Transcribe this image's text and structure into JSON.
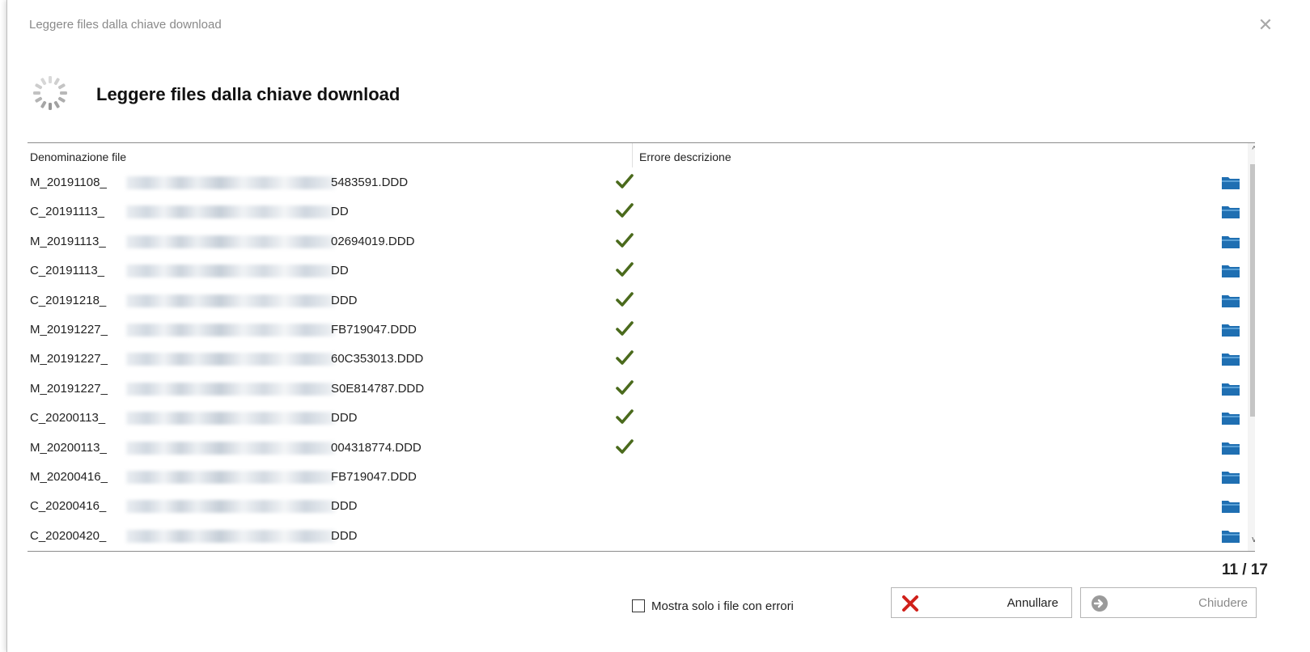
{
  "window": {
    "title": "Leggere files dalla chiave download",
    "close_glyph": "✕"
  },
  "header": {
    "title": "Leggere files dalla chiave download",
    "icon": "spinner-icon"
  },
  "grid": {
    "columns": {
      "file": "Denominazione file",
      "error": "Errore descrizione"
    },
    "rows": [
      {
        "prefix": "M_20191108_",
        "suffix": "5483591.DDD",
        "done": true,
        "error": ""
      },
      {
        "prefix": "C_20191113_",
        "suffix": "DD",
        "done": true,
        "error": ""
      },
      {
        "prefix": "M_20191113_",
        "suffix": "02694019.DDD",
        "done": true,
        "error": ""
      },
      {
        "prefix": "C_20191113_",
        "suffix": "DD",
        "done": true,
        "error": ""
      },
      {
        "prefix": "C_20191218_",
        "suffix": "DDD",
        "done": true,
        "error": ""
      },
      {
        "prefix": "M_20191227_",
        "suffix": "FB719047.DDD",
        "done": true,
        "error": ""
      },
      {
        "prefix": "M_20191227_",
        "suffix": "60C353013.DDD",
        "done": true,
        "error": ""
      },
      {
        "prefix": "M_20191227_",
        "suffix": "S0E814787.DDD",
        "done": true,
        "error": ""
      },
      {
        "prefix": "C_20200113_",
        "suffix": "DDD",
        "done": true,
        "error": ""
      },
      {
        "prefix": "M_20200113_",
        "suffix": "004318774.DDD",
        "done": true,
        "error": ""
      },
      {
        "prefix": "M_20200416_",
        "suffix": "FB719047.DDD",
        "done": false,
        "error": ""
      },
      {
        "prefix": "C_20200416_",
        "suffix": "DDD",
        "done": false,
        "error": ""
      },
      {
        "prefix": "C_20200420_",
        "suffix": "DDD",
        "done": false,
        "error": ""
      }
    ],
    "scroll_up": "^",
    "scroll_down": "v"
  },
  "footer": {
    "counter": "11 / 17",
    "filter_label": "Mostra solo i file con errori",
    "cancel_label": "Annullare",
    "close_label": "Chiudere"
  },
  "colors": {
    "check": "#4a6a1c",
    "folder": "#1f6fb2",
    "cancel_x": "#d0201a"
  }
}
